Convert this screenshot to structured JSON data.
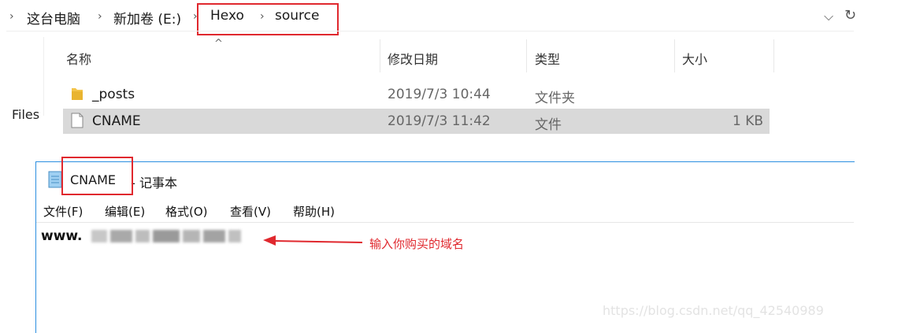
{
  "breadcrumb": {
    "this_pc": "这台电脑",
    "drive": "新加卷 (E:)",
    "folder1": "Hexo",
    "folder2": "source",
    "separator": "›"
  },
  "toolbar_partial": {
    "dropdown_glyph": "⌵",
    "refresh_glyph": "↻"
  },
  "columns": {
    "name": "名称",
    "date": "修改日期",
    "type": "类型",
    "size": "大小",
    "sort_glyph": "^"
  },
  "left_nav_partial": "Files",
  "files": [
    {
      "name": "_posts",
      "date": "2019/7/3 10:44",
      "type": "文件夹",
      "size": "",
      "icon": "folder-icon"
    },
    {
      "name": "CNAME",
      "date": "2019/7/3 11:42",
      "type": "文件",
      "size": "1 KB",
      "icon": "file-icon"
    }
  ],
  "notepad": {
    "title_name": "CNAME",
    "title_suffix": " - 记事本",
    "menu": [
      "文件(F)",
      "编辑(E)",
      "格式(O)",
      "查看(V)",
      "帮助(H)"
    ],
    "content_prefix": "www."
  },
  "annotation": {
    "text": "输入你购买的域名",
    "color": "#e0282e"
  },
  "watermark": "https://blog.csdn.net/qq_42540989"
}
